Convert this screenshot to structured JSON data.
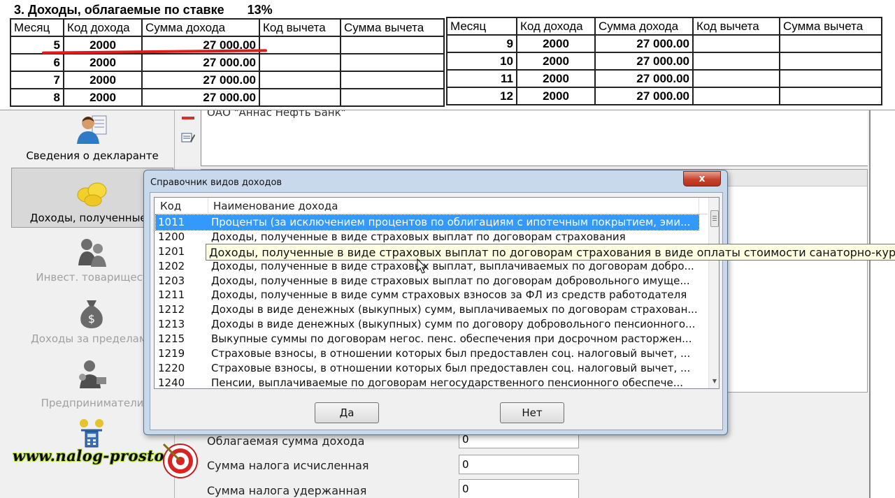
{
  "doc": {
    "title": "3. Доходы, облагаемые по ставке",
    "rate": "13%",
    "headers": [
      "Месяц",
      "Код дохода",
      "Сумма дохода",
      "Код вычета",
      "Сумма вычета"
    ],
    "left_rows": [
      {
        "month": "5",
        "code": "2000",
        "amount": "27 000.00"
      },
      {
        "month": "6",
        "code": "2000",
        "amount": "27 000.00"
      },
      {
        "month": "7",
        "code": "2000",
        "amount": "27 000.00"
      },
      {
        "month": "8",
        "code": "2000",
        "amount": "27 000.00"
      }
    ],
    "right_rows": [
      {
        "month": "9",
        "code": "2000",
        "amount": "27 000.00"
      },
      {
        "month": "10",
        "code": "2000",
        "amount": "27 000.00"
      },
      {
        "month": "11",
        "code": "2000",
        "amount": "27 000.00"
      },
      {
        "month": "12",
        "code": "2000",
        "amount": "27 000.00"
      }
    ]
  },
  "nav": {
    "items": [
      {
        "label": "Сведения о декларанте",
        "state": "normal",
        "icon": "person-document-icon"
      },
      {
        "label": "Доходы, полученные в",
        "state": "selected",
        "icon": "coins-icon"
      },
      {
        "label": "Инвест. товарищест",
        "state": "disabled",
        "icon": "people-icon"
      },
      {
        "label": "Доходы за пределами",
        "state": "disabled",
        "icon": "money-bag-icon"
      },
      {
        "label": "Предприниматели",
        "state": "disabled",
        "icon": "businessman-icon"
      },
      {
        "label": "",
        "state": "normal",
        "icon": "scales-calculator-icon"
      }
    ]
  },
  "bank": {
    "name": "ОАО \"Аннас Нефть Банк\""
  },
  "form": {
    "taxable_label": "Облагаемая сумма дохода",
    "taxable_value": "0",
    "calc_label": "Сумма налога исчисленная",
    "calc_value": "0",
    "withheld_label": "Сумма налога удержанная",
    "withheld_value": "0"
  },
  "watermark": "www.nalog-prosto.ru",
  "dialog": {
    "title": "Справочник видов доходов",
    "close": "x",
    "col_code": "Код",
    "col_name": "Наименование дохода",
    "selected_index": 0,
    "rows": [
      {
        "code": "1011",
        "name": "Проценты (за исключением процентов по облигациям с ипотечным покрытием, эми..."
      },
      {
        "code": "1200",
        "name": "Доходы, полученные в виде страховых выплат по договорам страхования"
      },
      {
        "code": "1201",
        "name": "Доходы, полученные в виде страховых выплат по договорам страхования в виде оплаты..."
      },
      {
        "code": "1202",
        "name": "Доходы, полученные в виде страховых выплат, выплачиваемых по договорам добро..."
      },
      {
        "code": "1203",
        "name": "Доходы, полученные в виде страховых выплат по договорам добровольного имуще..."
      },
      {
        "code": "1211",
        "name": "Доходы, полученные в виде сумм страховых взносов за ФЛ из средств работодателя"
      },
      {
        "code": "1212",
        "name": "Доходы в виде денежных (выкупных) сумм, выплачиваемых по договорам страхован..."
      },
      {
        "code": "1213",
        "name": "Доходы в виде денежных (выкупных) сумм по договору добровольного пенсионного..."
      },
      {
        "code": "1215",
        "name": "Выкупные суммы по договорам негос. пенс. обеспечения при досрочном расторжен..."
      },
      {
        "code": "1219",
        "name": "Страховые взносы, в отношении которых был предоставлен соц. налоговый вычет, ..."
      },
      {
        "code": "1220",
        "name": "Страховые взносы, в отношении которых был предоставлен соц. налоговый вычет, ..."
      },
      {
        "code": "1240",
        "name": "Пенсии, выплачиваемые по договорам негосударственного пенсионного обеспече..."
      }
    ],
    "tooltip": "Доходы, полученные в виде страховых выплат по договорам страхования в виде оплаты стоимости санаторно-курортных",
    "ok": "Да",
    "cancel": "Нет"
  },
  "colors": {
    "selection": "#3399ff",
    "underline": "#e21a1a",
    "dialog_frame": "#c9d9ec",
    "tooltip": "#ffffe1"
  }
}
